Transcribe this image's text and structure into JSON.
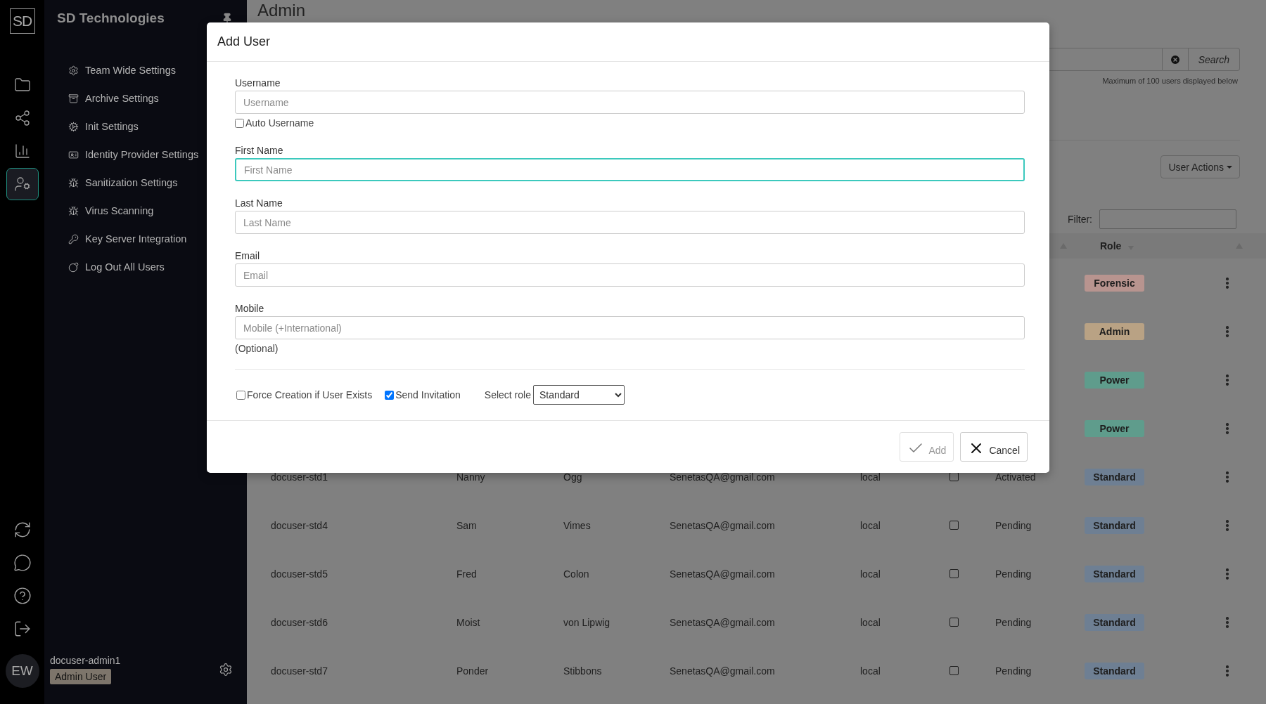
{
  "rail": {
    "logo": "SD",
    "items": [
      {
        "selected": false
      },
      {
        "selected": false
      },
      {
        "selected": false
      },
      {
        "selected": true
      }
    ],
    "avatar": "EW"
  },
  "sidebar": {
    "title": "SD Technologies",
    "items": [
      {
        "label": "Team Wide Settings"
      },
      {
        "label": "Archive Settings"
      },
      {
        "label": "Init Settings"
      },
      {
        "label": "Identity Provider Settings"
      },
      {
        "label": "Sanitization Settings"
      },
      {
        "label": "Virus Scanning"
      },
      {
        "label": "Key Server Integration"
      },
      {
        "label": "Log Out All Users"
      }
    ],
    "user": {
      "name": "docuser-admin1",
      "role": "Admin User"
    }
  },
  "main": {
    "heading": "Admin",
    "search": {
      "button": "Search",
      "note": "Maximum of 100 users displayed below"
    },
    "user_actions": "User Actions",
    "filter": {
      "label": "Filter:"
    },
    "table": {
      "columns": [
        {
          "label": "Role"
        }
      ],
      "rows": [
        {
          "role": "Forensic",
          "color": "#b8948f"
        },
        {
          "role": "Admin",
          "color": "#b9a284"
        },
        {
          "role": "Power",
          "color": "#5f9c8c"
        },
        {
          "role": "Power",
          "color": "#5f9c8c"
        },
        {
          "cells": [
            "docuser-std1",
            "Nanny",
            "Ogg",
            "SenetasQA@gmail.com",
            "local"
          ],
          "checked": false,
          "status": "Activated",
          "role": "Standard",
          "color": "#6e7f93"
        },
        {
          "cells": [
            "docuser-std4",
            "Sam",
            "Vimes",
            "SenetasQA@gmail.com",
            "local"
          ],
          "checked": false,
          "status": "Pending",
          "role": "Standard",
          "color": "#6e7f93"
        },
        {
          "cells": [
            "docuser-std5",
            "Fred",
            "Colon",
            "SenetasQA@gmail.com",
            "local"
          ],
          "checked": false,
          "status": "Pending",
          "role": "Standard",
          "color": "#6e7f93"
        },
        {
          "cells": [
            "docuser-std6",
            "Moist",
            "von Lipwig",
            "SenetasQA@gmail.com",
            "local"
          ],
          "checked": false,
          "status": "Pending",
          "role": "Standard",
          "color": "#6e7f93"
        },
        {
          "cells": [
            "docuser-std7",
            "Ponder",
            "Stibbons",
            "SenetasQA@gmail.com",
            "local"
          ],
          "checked": false,
          "status": "Pending",
          "role": "Standard",
          "color": "#6e7f93"
        }
      ]
    }
  },
  "modal": {
    "title": "Add User",
    "fields": [
      {
        "label": "Username",
        "placeholder": "Username",
        "focused": false,
        "option": {
          "label": "Auto Username",
          "checked": false
        }
      },
      {
        "label": "First Name",
        "placeholder": "First Name",
        "focused": true
      },
      {
        "label": "Last Name",
        "placeholder": "Last Name",
        "focused": false
      },
      {
        "label": "Email",
        "placeholder": "Email",
        "focused": false
      },
      {
        "label": "Mobile",
        "placeholder": "Mobile (+International)",
        "focused": false,
        "hint": "(Optional)"
      }
    ],
    "options": [
      {
        "kind": "checkbox",
        "label": "Force Creation if User Exists",
        "checked": false
      },
      {
        "kind": "checkbox",
        "label": "Send Invitation",
        "checked": true
      },
      {
        "kind": "select",
        "label": "Select role",
        "value": "Standard"
      }
    ],
    "buttons": [
      {
        "kind": "confirm",
        "label": "Add",
        "disabled": true
      },
      {
        "kind": "cancel",
        "label": "Cancel",
        "disabled": false
      }
    ]
  }
}
